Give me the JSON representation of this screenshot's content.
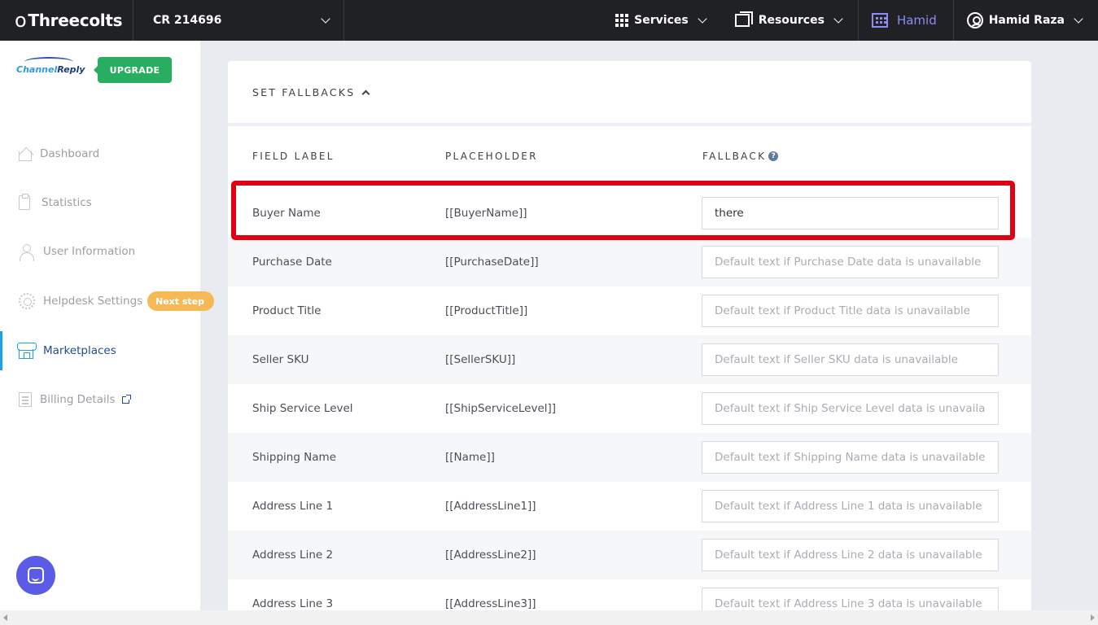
{
  "topbar": {
    "brand": "Threecolts",
    "account": "CR 214696",
    "services": "Services",
    "resources": "Resources",
    "workspace": "Hamid",
    "user": "Hamid Raza"
  },
  "sidebar": {
    "logo_part1": "Channel",
    "logo_part2": "Reply",
    "upgrade": "UPGRADE",
    "items": [
      {
        "label": "Dashboard"
      },
      {
        "label": "Statistics"
      },
      {
        "label": "User Information"
      },
      {
        "label": "Helpdesk Settings",
        "badge": "Next step"
      },
      {
        "label": "Marketplaces"
      },
      {
        "label": "Billing Details"
      }
    ]
  },
  "section": {
    "title": "SET FALLBACKS",
    "columns": {
      "label": "FIELD LABEL",
      "placeholder": "PLACEHOLDER",
      "fallback": "FALLBACK"
    },
    "help": "?"
  },
  "rows": [
    {
      "label": "Buyer Name",
      "placeholder": "[[BuyerName]]",
      "value": "there",
      "hint": ""
    },
    {
      "label": "Purchase Date",
      "placeholder": "[[PurchaseDate]]",
      "value": "",
      "hint": "Default text if Purchase Date data is unavailable"
    },
    {
      "label": "Product Title",
      "placeholder": "[[ProductTitle]]",
      "value": "",
      "hint": "Default text if Product Title data is unavailable"
    },
    {
      "label": "Seller SKU",
      "placeholder": "[[SellerSKU]]",
      "value": "",
      "hint": "Default text if Seller SKU data is unavailable"
    },
    {
      "label": "Ship Service Level",
      "placeholder": "[[ShipServiceLevel]]",
      "value": "",
      "hint": "Default text if Ship Service Level data is unavailable"
    },
    {
      "label": "Shipping Name",
      "placeholder": "[[Name]]",
      "value": "",
      "hint": "Default text if Shipping Name data is unavailable"
    },
    {
      "label": "Address Line 1",
      "placeholder": "[[AddressLine1]]",
      "value": "",
      "hint": "Default text if Address Line 1 data is unavailable"
    },
    {
      "label": "Address Line 2",
      "placeholder": "[[AddressLine2]]",
      "value": "",
      "hint": "Default text if Address Line 2 data is unavailable"
    },
    {
      "label": "Address Line 3",
      "placeholder": "[[AddressLine3]]",
      "value": "",
      "hint": "Default text if Address Line 3 data is unavailable"
    }
  ],
  "colors": {
    "highlight": "#e00012",
    "upgrade": "#27ae60",
    "badge": "#f7b955",
    "accent": "#1aa3e8",
    "workspace": "#8d8cf3"
  }
}
